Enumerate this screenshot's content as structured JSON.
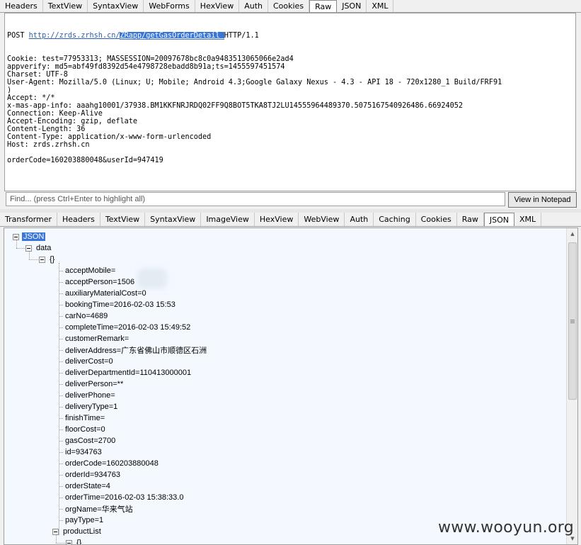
{
  "request_tabs": [
    "Headers",
    "TextView",
    "SyntaxView",
    "WebForms",
    "HexView",
    "Auth",
    "Cookies",
    "Raw",
    "JSON",
    "XML"
  ],
  "request_active_tab": "Raw",
  "raw": {
    "method": "POST ",
    "url_plain": "http://zrds.zrhsh.cn/",
    "url_selected": "ZRapp/getGasOrderDetail ",
    "protocol": "HTTP/1.1",
    "lines": [
      "Cookie: test=77953313; MASSESSION=20097678bc8c0a9483513065066e2ad4",
      "appverify: md5=abf49fd8392d54e4798728ebadd8b91a;ts=1455597451574",
      "Charset: UTF-8",
      "User-Agent: Mozilla/5.0 (Linux; U; Mobile; Android 4.3;Google Galaxy Nexus - 4.3 - API 18 - 720x1280_1 Build/FRF91",
      ")",
      "Accept: */*",
      "x-mas-app-info: aaahg10001/37938.BM1KKFNRJRDQ02FF9Q8BOT5TKA8TJ2LU14555964489370.5075167540926486.66924052",
      "Connection: Keep-Alive",
      "Accept-Encoding: gzip, deflate",
      "Content-Length: 36",
      "Content-Type: application/x-www-form-urlencoded",
      "Host: zrds.zrhsh.cn",
      "",
      "orderCode=160203880048&userId=947419"
    ]
  },
  "find": {
    "placeholder": "Find... (press Ctrl+Enter to highlight all)",
    "button_label": "View in Notepad"
  },
  "response_tabs": [
    "Transformer",
    "Headers",
    "TextView",
    "SyntaxView",
    "ImageView",
    "HexView",
    "WebView",
    "Auth",
    "Caching",
    "Cookies",
    "Raw",
    "JSON",
    "XML"
  ],
  "response_active_tab": "JSON",
  "tree": {
    "root": "JSON",
    "data": "data",
    "object": "{}",
    "fields": [
      "acceptMobile=",
      "acceptPerson=1506",
      "auxiliaryMaterialCost=0",
      "bookingTime=2016-02-03 15:53",
      "carNo=4689",
      "completeTime=2016-02-03 15:49:52",
      "customerRemark=",
      "deliverAddress=广东省佛山市顺德区石洲",
      "deliverCost=0",
      "deliverDepartmentId=110413000001",
      "deliverPerson=**",
      "deliverPhone=",
      "deliveryType=1",
      "finishTime=",
      "floorCost=0",
      "gasCost=2700",
      "id=934763",
      "orderCode=160203880048",
      "orderId=934763",
      "orderState=4",
      "orderTime=2016-02-03 15:38:33.0",
      "orgName=华来气站",
      "payType=1"
    ],
    "product_list": "productList",
    "product_object": "{}"
  },
  "watermark": "www.wooyun.org"
}
